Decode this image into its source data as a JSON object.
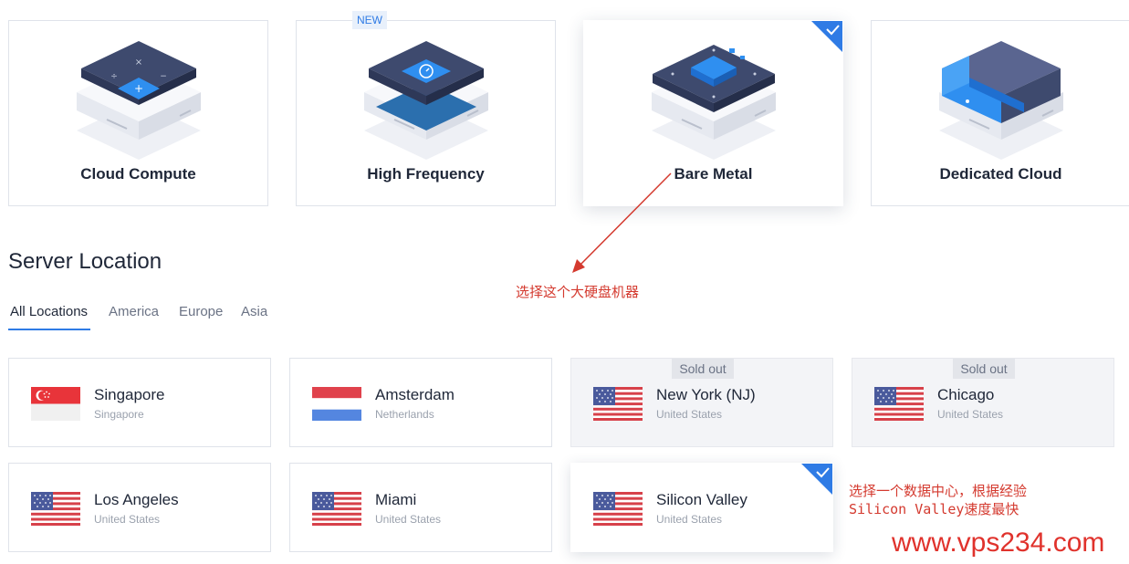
{
  "server_types": [
    {
      "name": "Cloud Compute",
      "selected": false,
      "badge": ""
    },
    {
      "name": "High Frequency",
      "selected": false,
      "badge": "NEW"
    },
    {
      "name": "Bare Metal",
      "selected": true,
      "badge": ""
    },
    {
      "name": "Dedicated Cloud",
      "selected": false,
      "badge": ""
    }
  ],
  "server_location": {
    "title": "Server Location",
    "tabs": [
      {
        "label": "All Locations",
        "active": true
      },
      {
        "label": "America",
        "active": false
      },
      {
        "label": "Europe",
        "active": false
      },
      {
        "label": "Asia",
        "active": false
      }
    ],
    "locations": [
      {
        "city": "Singapore",
        "country": "Singapore",
        "flag": "singapore-flag",
        "status": "",
        "selected": false
      },
      {
        "city": "Amsterdam",
        "country": "Netherlands",
        "flag": "netherlands-flag",
        "status": "",
        "selected": false
      },
      {
        "city": "New York (NJ)",
        "country": "United States",
        "flag": "us-flag",
        "status": "Sold out",
        "selected": false
      },
      {
        "city": "Chicago",
        "country": "United States",
        "flag": "us-flag",
        "status": "Sold out",
        "selected": false
      },
      {
        "city": "Los Angeles",
        "country": "United States",
        "flag": "us-flag",
        "status": "",
        "selected": false
      },
      {
        "city": "Miami",
        "country": "United States",
        "flag": "us-flag",
        "status": "",
        "selected": false
      },
      {
        "city": "Silicon Valley",
        "country": "United States",
        "flag": "us-flag",
        "status": "",
        "selected": true
      }
    ]
  },
  "annotations": {
    "bare_metal_note": "选择这个大硬盘机器",
    "location_note_line1": "选择一个数据中心，根据经验",
    "location_note_line2": "Silicon Valley速度最快",
    "watermark": "www.vps234.com"
  },
  "colors": {
    "accent": "#2f7be5",
    "annotation": "#d43a2f",
    "watermark": "#e0322c"
  }
}
